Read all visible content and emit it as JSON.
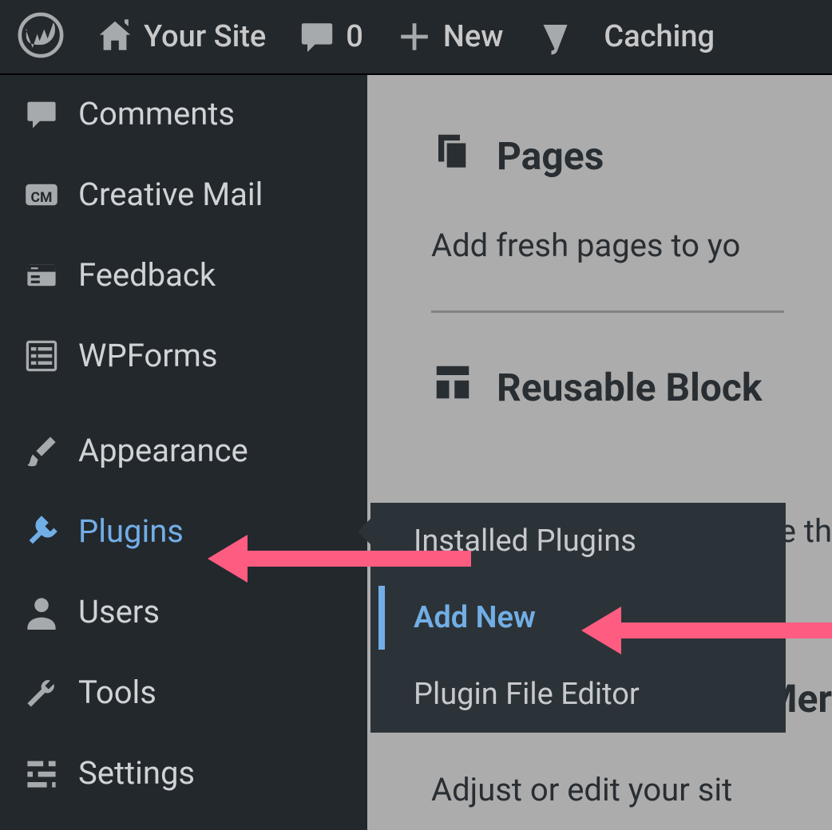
{
  "topbar": {
    "site_name": "Your Site",
    "comments_count": "0",
    "new_label": "New",
    "caching_label": "Caching"
  },
  "sidebar": {
    "items": [
      {
        "label": "Comments"
      },
      {
        "label": "Creative Mail"
      },
      {
        "label": "Feedback"
      },
      {
        "label": "WPForms"
      },
      {
        "label": "Appearance"
      },
      {
        "label": "Plugins"
      },
      {
        "label": "Users"
      },
      {
        "label": "Tools"
      },
      {
        "label": "Settings"
      }
    ]
  },
  "flyout": {
    "items": [
      {
        "label": "Installed Plugins"
      },
      {
        "label": "Add New"
      },
      {
        "label": "Plugin File Editor"
      }
    ]
  },
  "content": {
    "pages_title": "Pages",
    "pages_desc": "Add fresh pages to yo",
    "reusable_title": "Reusable Block",
    "partial1": "e th",
    "menus_title": "Mer",
    "adjust_text": "Adjust or edit your sit"
  }
}
